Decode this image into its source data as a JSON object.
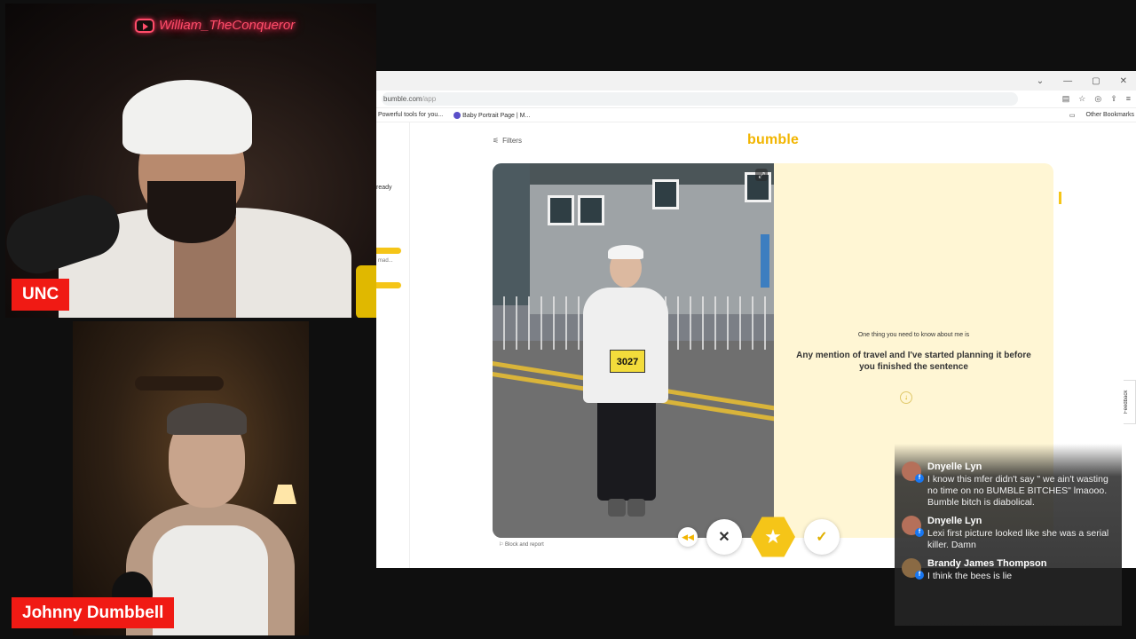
{
  "stream": {
    "neon_sign": "William_TheConqueror",
    "host1_name": "UNC",
    "host2_name": "Johnny Dumbbell"
  },
  "browser": {
    "url_host": "bumble.com",
    "url_path": "/app",
    "bookmarks": [
      "Powerful tools for you...",
      "Baby Portrait Page | M...",
      "Other Bookmarks"
    ],
    "window_controls": [
      "⌄",
      "—",
      "▢",
      "✕"
    ]
  },
  "app": {
    "logo": "bumble",
    "filters_label": "Filters",
    "sidebar_text": "ready",
    "sidebar_small": "mad...",
    "bib_number": "3027",
    "bio_heading": "One thing you need to know about me is",
    "bio_text": "Any mention of travel and I've started planning it before you finished the sentence",
    "block_report": "Block and report",
    "feedback": "Feedback",
    "colors": {
      "brand": "#f5c518",
      "bio_bg": "#fff6d4"
    }
  },
  "chat": {
    "messages": [
      {
        "name": "Dnyelle Lyn",
        "text": "I know this mfer didn't say \" we ain't wasting no time on no BUMBLE BITCHES\" lmaooo. Bumble bitch is diabolical."
      },
      {
        "name": "Dnyelle Lyn",
        "text": "Lexi first picture looked like she was a serial killer. Damn"
      },
      {
        "name": "Brandy James Thompson",
        "text": "I think the bees is lie"
      }
    ]
  }
}
